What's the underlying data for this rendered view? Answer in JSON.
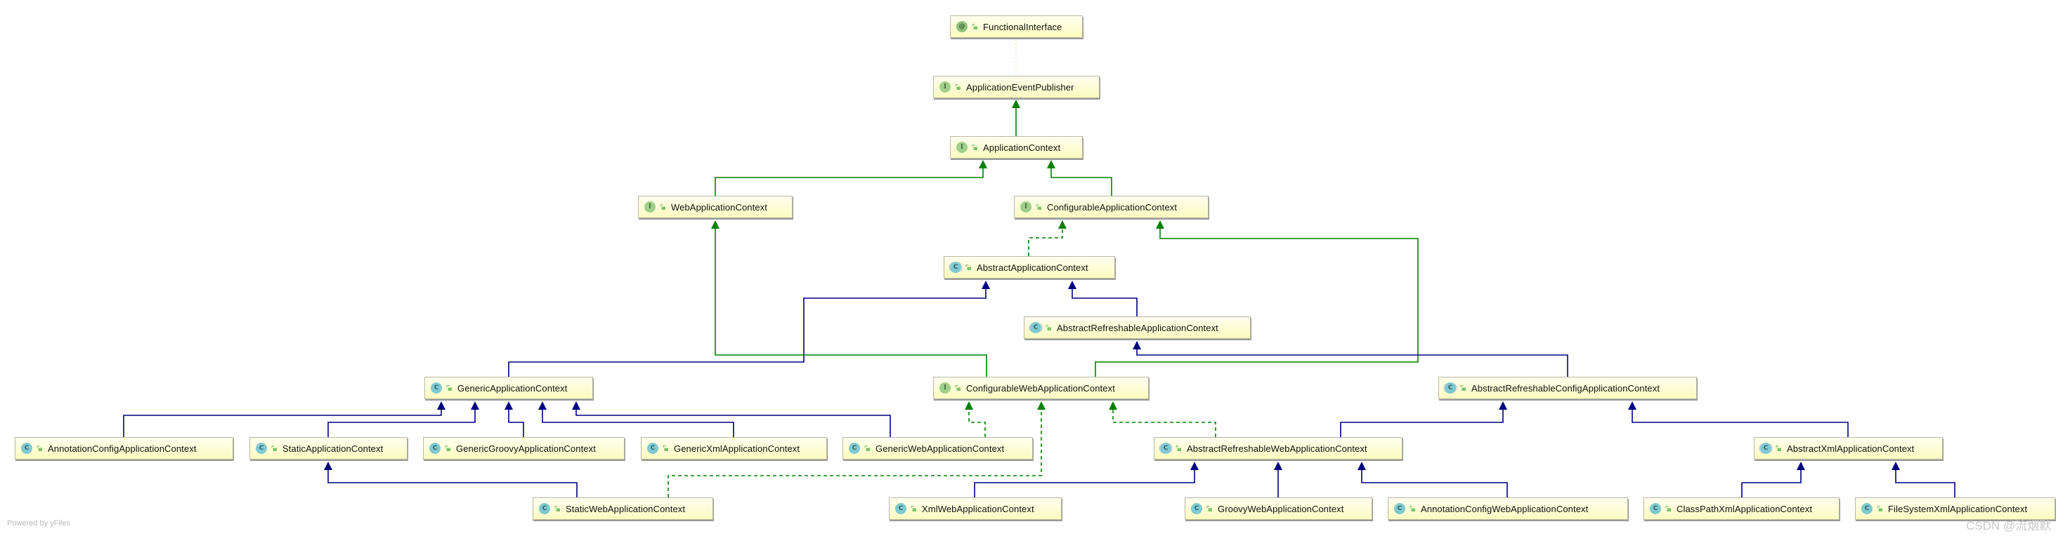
{
  "diagram": {
    "type": "uml-class-hierarchy",
    "colors": {
      "extends": "#000080",
      "implements_interface": "#008000",
      "annotation_link": "#c8b060",
      "node_fill_top": "#fffff0",
      "node_fill_bottom": "#fbfbbf"
    },
    "nodes": [
      {
        "id": "FunctionalInterface",
        "label": "FunctionalInterface",
        "kind": "annotation",
        "kind_glyph": "@"
      },
      {
        "id": "ApplicationEventPublisher",
        "label": "ApplicationEventPublisher",
        "kind": "interface",
        "kind_glyph": "I"
      },
      {
        "id": "ApplicationContext",
        "label": "ApplicationContext",
        "kind": "interface",
        "kind_glyph": "I"
      },
      {
        "id": "WebApplicationContext",
        "label": "WebApplicationContext",
        "kind": "interface",
        "kind_glyph": "I"
      },
      {
        "id": "ConfigurableApplicationContext",
        "label": "ConfigurableApplicationContext",
        "kind": "interface",
        "kind_glyph": "I"
      },
      {
        "id": "AbstractApplicationContext",
        "label": "AbstractApplicationContext",
        "kind": "abstract",
        "kind_glyph": "C"
      },
      {
        "id": "AbstractRefreshableApplicationContext",
        "label": "AbstractRefreshableApplicationContext",
        "kind": "abstract",
        "kind_glyph": "C"
      },
      {
        "id": "GenericApplicationContext",
        "label": "GenericApplicationContext",
        "kind": "class",
        "kind_glyph": "C"
      },
      {
        "id": "ConfigurableWebApplicationContext",
        "label": "ConfigurableWebApplicationContext",
        "kind": "interface",
        "kind_glyph": "I"
      },
      {
        "id": "AbstractRefreshableConfigApplicationContext",
        "label": "AbstractRefreshableConfigApplicationContext",
        "kind": "abstract",
        "kind_glyph": "C"
      },
      {
        "id": "AnnotationConfigApplicationContext",
        "label": "AnnotationConfigApplicationContext",
        "kind": "class",
        "kind_glyph": "C"
      },
      {
        "id": "StaticApplicationContext",
        "label": "StaticApplicationContext",
        "kind": "class",
        "kind_glyph": "C"
      },
      {
        "id": "GenericGroovyApplicationContext",
        "label": "GenericGroovyApplicationContext",
        "kind": "class",
        "kind_glyph": "C"
      },
      {
        "id": "GenericXmlApplicationContext",
        "label": "GenericXmlApplicationContext",
        "kind": "class",
        "kind_glyph": "C"
      },
      {
        "id": "GenericWebApplicationContext",
        "label": "GenericWebApplicationContext",
        "kind": "class",
        "kind_glyph": "C"
      },
      {
        "id": "AbstractRefreshableWebApplicationContext",
        "label": "AbstractRefreshableWebApplicationContext",
        "kind": "abstract",
        "kind_glyph": "C"
      },
      {
        "id": "AbstractXmlApplicationContext",
        "label": "AbstractXmlApplicationContext",
        "kind": "abstract",
        "kind_glyph": "C"
      },
      {
        "id": "StaticWebApplicationContext",
        "label": "StaticWebApplicationContext",
        "kind": "class",
        "kind_glyph": "C"
      },
      {
        "id": "XmlWebApplicationContext",
        "label": "XmlWebApplicationContext",
        "kind": "class",
        "kind_glyph": "C"
      },
      {
        "id": "GroovyWebApplicationContext",
        "label": "GroovyWebApplicationContext",
        "kind": "class",
        "kind_glyph": "C"
      },
      {
        "id": "AnnotationConfigWebApplicationContext",
        "label": "AnnotationConfigWebApplicationContext",
        "kind": "class",
        "kind_glyph": "C"
      },
      {
        "id": "ClassPathXmlApplicationContext",
        "label": "ClassPathXmlApplicationContext",
        "kind": "class",
        "kind_glyph": "C"
      },
      {
        "id": "FileSystemXmlApplicationContext",
        "label": "FileSystemXmlApplicationContext",
        "kind": "class",
        "kind_glyph": "C"
      }
    ],
    "edges": [
      {
        "from": "ApplicationEventPublisher",
        "to": "FunctionalInterface",
        "type": "annotated"
      },
      {
        "from": "ApplicationContext",
        "to": "ApplicationEventPublisher",
        "type": "interface-extends"
      },
      {
        "from": "WebApplicationContext",
        "to": "ApplicationContext",
        "type": "interface-extends"
      },
      {
        "from": "ConfigurableApplicationContext",
        "to": "ApplicationContext",
        "type": "interface-extends"
      },
      {
        "from": "AbstractApplicationContext",
        "to": "ConfigurableApplicationContext",
        "type": "implements"
      },
      {
        "from": "AbstractRefreshableApplicationContext",
        "to": "AbstractApplicationContext",
        "type": "extends"
      },
      {
        "from": "GenericApplicationContext",
        "to": "AbstractApplicationContext",
        "type": "extends"
      },
      {
        "from": "ConfigurableWebApplicationContext",
        "to": "WebApplicationContext",
        "type": "interface-extends"
      },
      {
        "from": "ConfigurableWebApplicationContext",
        "to": "ConfigurableApplicationContext",
        "type": "interface-extends"
      },
      {
        "from": "AbstractRefreshableConfigApplicationContext",
        "to": "AbstractRefreshableApplicationContext",
        "type": "extends"
      },
      {
        "from": "AnnotationConfigApplicationContext",
        "to": "GenericApplicationContext",
        "type": "extends"
      },
      {
        "from": "StaticApplicationContext",
        "to": "GenericApplicationContext",
        "type": "extends"
      },
      {
        "from": "GenericGroovyApplicationContext",
        "to": "GenericApplicationContext",
        "type": "extends"
      },
      {
        "from": "GenericXmlApplicationContext",
        "to": "GenericApplicationContext",
        "type": "extends"
      },
      {
        "from": "GenericWebApplicationContext",
        "to": "GenericApplicationContext",
        "type": "extends"
      },
      {
        "from": "GenericWebApplicationContext",
        "to": "ConfigurableWebApplicationContext",
        "type": "implements"
      },
      {
        "from": "StaticWebApplicationContext",
        "to": "StaticApplicationContext",
        "type": "extends"
      },
      {
        "from": "StaticWebApplicationContext",
        "to": "ConfigurableWebApplicationContext",
        "type": "implements"
      },
      {
        "from": "AbstractRefreshableWebApplicationContext",
        "to": "AbstractRefreshableConfigApplicationContext",
        "type": "extends"
      },
      {
        "from": "AbstractRefreshableWebApplicationContext",
        "to": "ConfigurableWebApplicationContext",
        "type": "implements"
      },
      {
        "from": "AbstractXmlApplicationContext",
        "to": "AbstractRefreshableConfigApplicationContext",
        "type": "extends"
      },
      {
        "from": "XmlWebApplicationContext",
        "to": "AbstractRefreshableWebApplicationContext",
        "type": "extends"
      },
      {
        "from": "GroovyWebApplicationContext",
        "to": "AbstractRefreshableWebApplicationContext",
        "type": "extends"
      },
      {
        "from": "AnnotationConfigWebApplicationContext",
        "to": "AbstractRefreshableWebApplicationContext",
        "type": "extends"
      },
      {
        "from": "ClassPathXmlApplicationContext",
        "to": "AbstractXmlApplicationContext",
        "type": "extends"
      },
      {
        "from": "FileSystemXmlApplicationContext",
        "to": "AbstractXmlApplicationContext",
        "type": "extends"
      }
    ]
  },
  "footer": {
    "powered_by": "Powered by yFiles"
  },
  "watermark": "CSDN @流烟默"
}
